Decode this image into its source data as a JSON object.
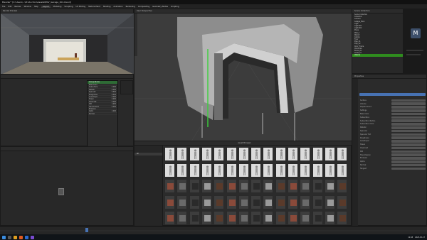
{
  "window": {
    "title": "Blender* [C:\\Users\\...\\Production\\Assets\\ENV_Garage_001.blend]"
  },
  "menu": {
    "items": [
      "File",
      "Edit",
      "Render",
      "Window",
      "Help",
      "Layout",
      "Modeling",
      "Sculpting",
      "UV Editing",
      "Texture Paint",
      "Shading",
      "Animation",
      "Rendering",
      "Compositing",
      "Geometry Nodes",
      "Scripting"
    ],
    "active_index": 5
  },
  "render_preview": {
    "header": "Render Preview"
  },
  "node_panel": {
    "title": "Group Node",
    "props": [
      {
        "label": "Base Color",
        "value": ""
      },
      {
        "label": "Subsurface",
        "value": "0.000"
      },
      {
        "label": "Metallic",
        "value": "0.000"
      },
      {
        "label": "Specular",
        "value": "0.500"
      },
      {
        "label": "Roughness",
        "value": "0.500"
      },
      {
        "label": "Anisotropic",
        "value": "0.000"
      },
      {
        "label": "Sheen",
        "value": "0.000"
      },
      {
        "label": "Clearcoat",
        "value": "0.000"
      },
      {
        "label": "IOR",
        "value": "1.450"
      },
      {
        "label": "Transmission",
        "value": "0.000"
      },
      {
        "label": "Emission",
        "value": ""
      },
      {
        "label": "Alpha",
        "value": "1.000"
      },
      {
        "label": "Normal",
        "value": ""
      }
    ]
  },
  "viewport": {
    "header": "User Perspective"
  },
  "asset_browser": {
    "header": "Asset Browser",
    "catalog_item": "All",
    "rows": 5,
    "cols": 15
  },
  "outliner": {
    "header": "Scene Collection",
    "rows": [
      "Scene Collection",
      "Collection",
      "Camera",
      "Garage_Main",
      "Light",
      "Light.001",
      "Light.002",
      "Props",
      "Wall_A",
      "Wall_B",
      "Ceiling",
      "Floor",
      "Pipe_01",
      "Pipe_02",
      "Door_Frame",
      "Character",
      "Barrel_01",
      "Crate_01",
      "Vehicle"
    ],
    "selected_index": 18
  },
  "properties": {
    "header": "Properties",
    "rows": [
      "Surface",
      "Volume",
      "Displacement",
      "Settings",
      "Base Color",
      "Subsurface",
      "Subsurface Radius",
      "Subsurface Color",
      "Metallic",
      "Specular",
      "Specular Tint",
      "Roughness",
      "Anisotropic",
      "Sheen",
      "Clearcoat",
      "IOR",
      "Transmission",
      "Emission",
      "Alpha",
      "Normal",
      "Tangent"
    ]
  },
  "colors": {
    "accent_green": "#2f8c1e",
    "accent_blue": "#4772b3"
  },
  "taskbar": {
    "time": "12:48",
    "date": "2023-05-17"
  }
}
